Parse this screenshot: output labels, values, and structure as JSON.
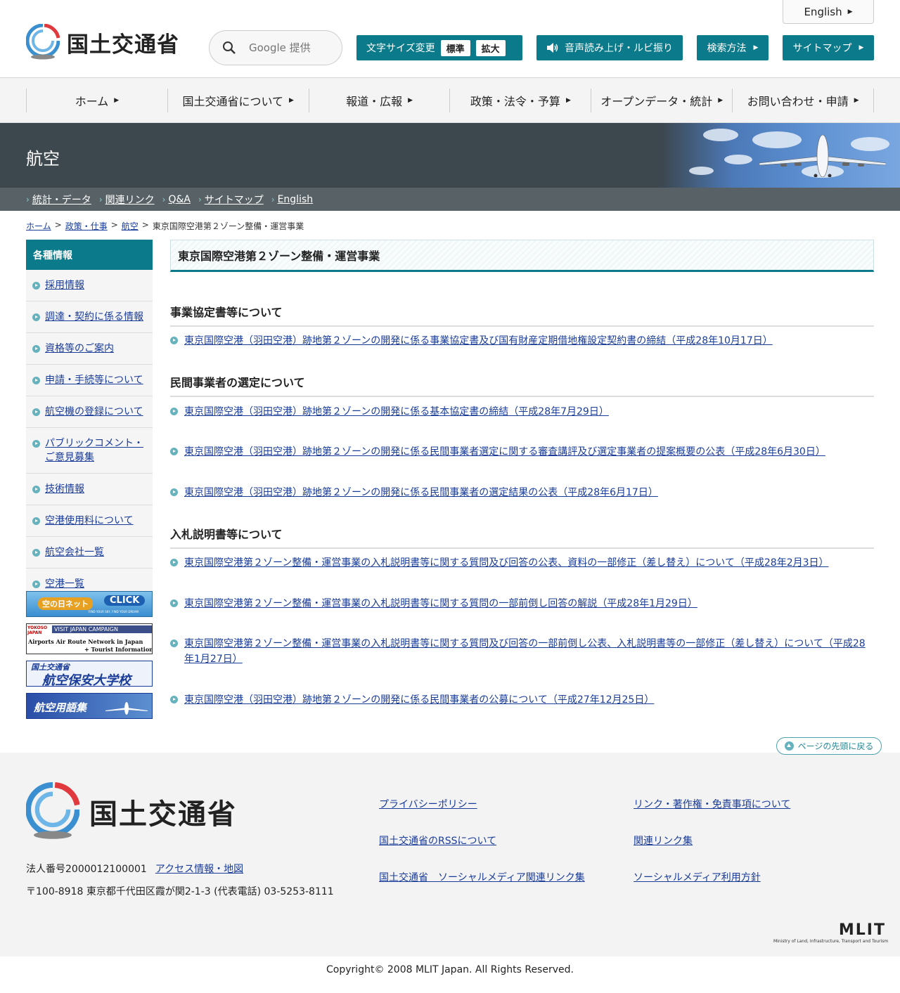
{
  "header": {
    "logo_text": "国土交通省",
    "english": "English",
    "search_placeholder": "Google 提供",
    "font_size_label": "文字サイズ変更",
    "font_size_standard": "標準",
    "font_size_large": "拡大",
    "voice_label": "音声読み上げ・ルビ振り",
    "search_method": "検索方法",
    "sitemap": "サイトマップ"
  },
  "gnav": [
    {
      "label": "ホーム"
    },
    {
      "label": "国土交通省について"
    },
    {
      "label": "報道・広報"
    },
    {
      "label": "政策・法令・予算"
    },
    {
      "label": "オープンデータ・統計"
    },
    {
      "label": "お問い合わせ・申請"
    }
  ],
  "banner": {
    "title": "航空"
  },
  "sublinks": [
    {
      "label": "統計・データ"
    },
    {
      "label": "関連リンク"
    },
    {
      "label": "Q&A"
    },
    {
      "label": "サイトマップ"
    },
    {
      "label": "English"
    }
  ],
  "breadcrumb": {
    "home": "ホーム",
    "policy": "政策・仕事",
    "aviation": "航空",
    "current": "東京国際空港第２ゾーン整備・運営事業",
    "sep": ">"
  },
  "sidebar": {
    "heading": "各種情報",
    "items": [
      {
        "label": "採用情報"
      },
      {
        "label": "調達・契約に係る情報"
      },
      {
        "label": "資格等のご案内"
      },
      {
        "label": "申請・手続等について"
      },
      {
        "label": "航空機の登録について"
      },
      {
        "label": "パブリックコメント・ご意見募集"
      },
      {
        "label": "技術情報"
      },
      {
        "label": "空港使用料について"
      },
      {
        "label": "航空会社一覧"
      },
      {
        "label": "空港一覧"
      }
    ],
    "banners": {
      "b1_text": "空の日ネット",
      "b1_click": "CLICK",
      "b1_sub": "FIND YOUR SKY, FIND YOUR DREAM",
      "b2_top": "VISIT JAPAN CAMPAIGN",
      "b2_logo": "YOKOSO JAPAN",
      "b2_main": "Airports Air Route Network in Japan",
      "b2_sub": "+ Tourist Information",
      "b3_top": "国土交通省",
      "b3_main": "航空保安大学校",
      "b4_text": "航空用語集"
    }
  },
  "main": {
    "title": "東京国際空港第２ゾーン整備・運営事業",
    "sections": [
      {
        "heading": "事業協定書等について",
        "links": [
          "東京国際空港（羽田空港）跡地第２ゾーンの開発に係る事業協定書及び国有財産定期借地権設定契約書の締結（平成28年10月17日）"
        ]
      },
      {
        "heading": "民間事業者の選定について",
        "links": [
          "東京国際空港（羽田空港）跡地第２ゾーンの開発に係る基本協定書の締結（平成28年7月29日）",
          "東京国際空港（羽田空港）跡地第２ゾーンの開発に係る民間事業者選定に関する審査講評及び選定事業者の提案概要の公表（平成28年6月30日）",
          "東京国際空港（羽田空港）跡地第２ゾーンの開発に係る民間事業者の選定結果の公表（平成28年6月17日）"
        ]
      },
      {
        "heading": "入札説明書等について",
        "links": [
          "東京国際空港第２ゾーン整備・運営事業の入札説明書等に関する質問及び回答の公表、資料の一部修正（差し替え）について（平成28年2月3日）",
          "東京国際空港第２ゾーン整備・運営事業の入札説明書等に関する質問の一部前倒し回答の解説（平成28年1月29日）",
          "東京国際空港第２ゾーン整備・運営事業の入札説明書等に関する質問及び回答の一部前倒し公表、入札説明書等の一部修正（差し替え）について（平成28年1月27日）",
          "東京国際空港（羽田空港）跡地第２ゾーンの開発に係る民間事業者の公募について（平成27年12月25日）"
        ]
      }
    ],
    "pagetop": "ページの先頭に戻る"
  },
  "footer": {
    "logo_text": "国土交通省",
    "corp_number": "法人番号2000012100001",
    "access": "アクセス情報・地図",
    "address": "〒100-8918 東京都千代田区霞が関2-1-3 (代表電話) 03-5253-8111",
    "links": [
      "プライバシーポリシー",
      "リンク・著作権・免責事項について",
      "国土交通省のRSSについて",
      "関連リンク集",
      "国土交通省　ソーシャルメディア関連リンク集",
      "ソーシャルメディア利用方針"
    ],
    "mlit": "MLIT",
    "mlit_sub": "Ministry of Land, Infrastructure, Transport and Tourism",
    "copyright": "Copyright© 2008 MLIT Japan. All Rights Reserved."
  },
  "colors": {
    "accent": "#0b7a8a",
    "banner_bg": "#3c474e",
    "link": "#1a3c99"
  }
}
